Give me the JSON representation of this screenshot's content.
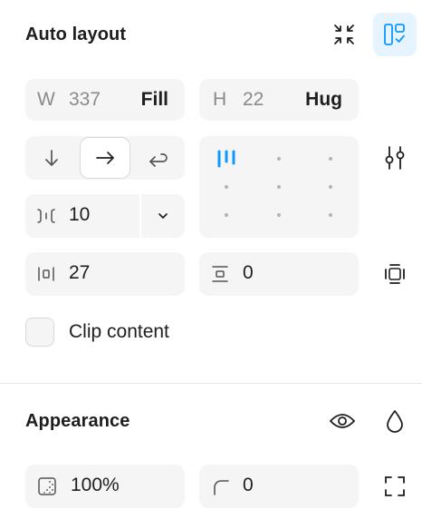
{
  "auto_layout": {
    "title": "Auto layout",
    "width": {
      "label": "W",
      "value": "337",
      "mode": "Fill"
    },
    "height": {
      "label": "H",
      "value": "22",
      "mode": "Hug"
    },
    "gap": {
      "value": "10"
    },
    "padding_horizontal": {
      "value": "27"
    },
    "padding_vertical": {
      "value": "0"
    },
    "clip_content": {
      "label": "Clip content",
      "checked": false
    },
    "direction": {
      "selected": "horizontal"
    },
    "accent_color": "#0d99ff"
  },
  "appearance": {
    "title": "Appearance",
    "opacity": {
      "value": "100%"
    },
    "corner_radius": {
      "value": "0"
    }
  }
}
